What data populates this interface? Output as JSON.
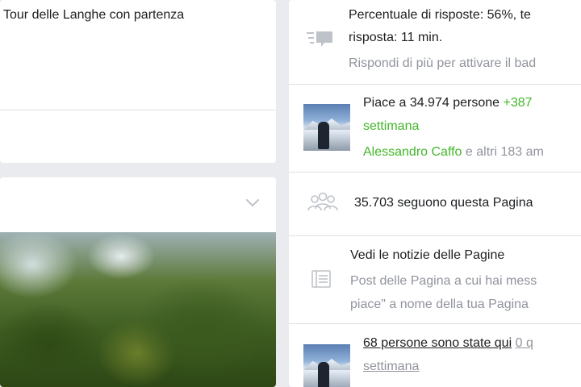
{
  "left_feed": {
    "post_text": "Tour delle Langhe con partenza"
  },
  "right_panel": {
    "response": {
      "line1": "Percentuale di risposte: 56%, te",
      "line2": "risposta: 11 min.",
      "line3": "Rispondi di più per attivare il bad"
    },
    "likes": {
      "text": "Piace a 34.974 persone",
      "delta": "+387",
      "week": "settimana",
      "friend_name": "Alessandro Caffo",
      "friend_suffix": "e altri 183 am"
    },
    "followers": {
      "text": "35.703 seguono questa Pagina"
    },
    "pages_feed": {
      "title": "Vedi le notizie delle Pagine",
      "desc_line1": "Post delle Pagina a cui hai mess",
      "desc_line2": "piace\" a nome della tua Pagina"
    },
    "checkins": {
      "text": "68 persone sono state qui",
      "suffix": "0 q",
      "week": "settimana"
    }
  },
  "colors": {
    "background": "#e9ebee",
    "text": "#1c1e21",
    "secondary": "#90949c",
    "positive": "#42b72a",
    "divider": "#dddfe2"
  }
}
